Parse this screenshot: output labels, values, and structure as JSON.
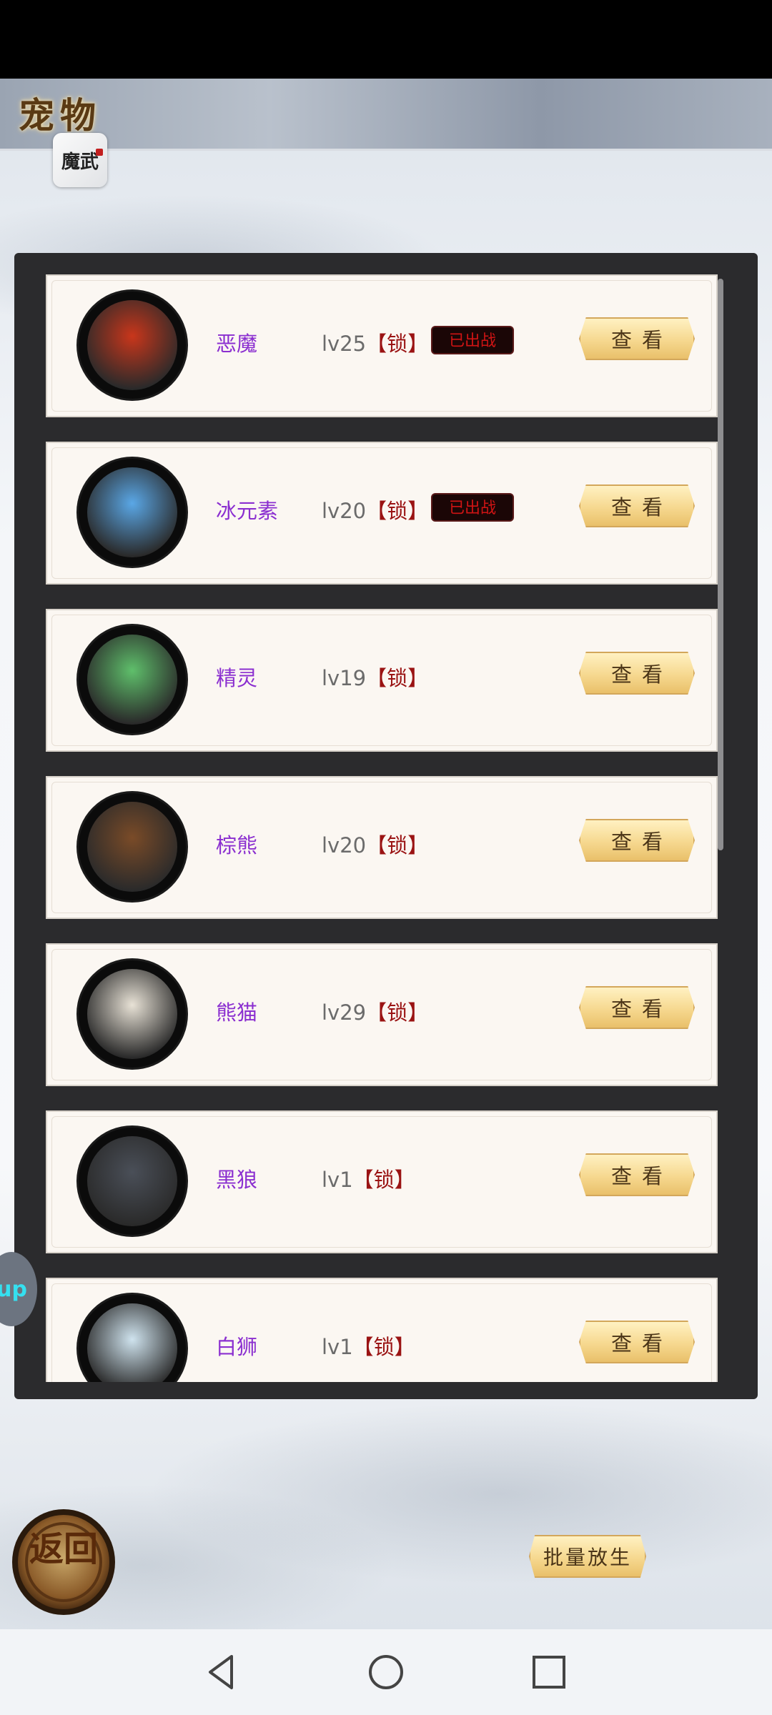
{
  "header": {
    "title": "宠物",
    "app_badge_text": "魔武"
  },
  "pets": [
    {
      "name": "恶魔",
      "level": "lv25",
      "lock": "【锁】",
      "deployed_label": "已出战",
      "view_label": "查看",
      "avatar_icon": "demon-avatar-icon",
      "accent": "#c9361b"
    },
    {
      "name": "冰元素",
      "level": "lv20",
      "lock": "【锁】",
      "deployed_label": "已出战",
      "view_label": "查看",
      "avatar_icon": "ice-elemental-avatar-icon",
      "accent": "#5aa7e6"
    },
    {
      "name": "精灵",
      "level": "lv19",
      "lock": "【锁】",
      "deployed_label": "",
      "view_label": "查看",
      "avatar_icon": "elf-avatar-icon",
      "accent": "#5fbf6b"
    },
    {
      "name": "棕熊",
      "level": "lv20",
      "lock": "【锁】",
      "deployed_label": "",
      "view_label": "查看",
      "avatar_icon": "brown-bear-avatar-icon",
      "accent": "#7a4b28"
    },
    {
      "name": "熊猫",
      "level": "lv29",
      "lock": "【锁】",
      "deployed_label": "",
      "view_label": "查看",
      "avatar_icon": "panda-avatar-icon",
      "accent": "#e8e2d6"
    },
    {
      "name": "黑狼",
      "level": "lv1",
      "lock": "【锁】",
      "deployed_label": "",
      "view_label": "查看",
      "avatar_icon": "black-wolf-avatar-icon",
      "accent": "#4a4f58"
    },
    {
      "name": "白狮",
      "level": "lv1",
      "lock": "【锁】",
      "deployed_label": "",
      "view_label": "查看",
      "avatar_icon": "white-lion-avatar-icon",
      "accent": "#cfe3ee"
    }
  ],
  "floating_bubble_text": "up",
  "footer": {
    "back_label": "返回",
    "batch_release_label": "批量放生"
  },
  "colors": {
    "pet_name": "#8b2fd0",
    "lock": "#9a1313",
    "deployed_text": "#d01414",
    "panel": "#2b2b2d",
    "button_gold": "#f6d88f"
  }
}
